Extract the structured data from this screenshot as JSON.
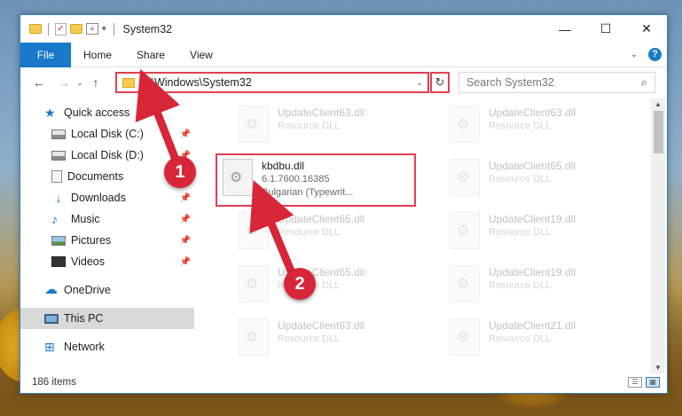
{
  "window": {
    "title": "System32",
    "controls": {
      "minimize": "—",
      "maximize": "☐",
      "close": "✕"
    }
  },
  "quick_access_toolbar": {
    "separator_glyph": "|"
  },
  "ribbon": {
    "tabs": [
      "File",
      "Home",
      "Share",
      "View"
    ],
    "expand_glyph": "⌄",
    "help_glyph": "?"
  },
  "navigation": {
    "back_glyph": "←",
    "forward_glyph": "→",
    "recent_glyph": "⌄",
    "up_glyph": "↑",
    "address": "C:\\Windows\\System32",
    "refresh_glyph": "↻",
    "search_placeholder": "Search System32"
  },
  "sidebar": {
    "items": [
      {
        "label": "Quick access",
        "icon": "star-icon",
        "pinned": false
      },
      {
        "label": "Local Disk (C:)",
        "icon": "disk-icon",
        "pinned": true
      },
      {
        "label": "Local Disk (D:)",
        "icon": "disk-icon",
        "pinned": true
      },
      {
        "label": "Documents",
        "icon": "documents-icon",
        "pinned": true
      },
      {
        "label": "Downloads",
        "icon": "downloads-icon",
        "pinned": true
      },
      {
        "label": "Music",
        "icon": "music-icon",
        "pinned": true
      },
      {
        "label": "Pictures",
        "icon": "pictures-icon",
        "pinned": true
      },
      {
        "label": "Videos",
        "icon": "videos-icon",
        "pinned": true
      },
      {
        "label": "OneDrive",
        "icon": "onedrive-icon",
        "pinned": false
      },
      {
        "label": "This PC",
        "icon": "this-pc-icon",
        "pinned": false,
        "selected": true
      },
      {
        "label": "Network",
        "icon": "network-icon",
        "pinned": false
      }
    ]
  },
  "files": {
    "left_column": [
      {
        "name": "UpdateClient63.dll",
        "desc": "Resource DLL"
      },
      {
        "name": "UpdateClient65.dll",
        "desc": "Resource DLL"
      },
      {
        "name": "UpdateClient65.dll",
        "desc": "Resource DLL"
      },
      {
        "name": "UpdateClient63.dll",
        "desc": "Resource DLL"
      }
    ],
    "right_column": [
      {
        "name": "UpdateClient63.dll",
        "desc": "Resource DLL"
      },
      {
        "name": "UpdateClient65.dll",
        "desc": "Resource DLL"
      },
      {
        "name": "UpdateClient19.dll",
        "desc": "Resource DLL"
      },
      {
        "name": "UpdateClient19.dll",
        "desc": "Resource DLL"
      },
      {
        "name": "UpdateClient21.dll",
        "desc": "Resource DLL"
      }
    ],
    "highlighted": {
      "name": "kbdbu.dll",
      "version": "6.1.7600.16385",
      "description": "Bulgarian (Typewrit..."
    }
  },
  "status": {
    "item_count": "186 items"
  },
  "annotations": {
    "step1": "1",
    "step2": "2",
    "color": "#d72638"
  }
}
